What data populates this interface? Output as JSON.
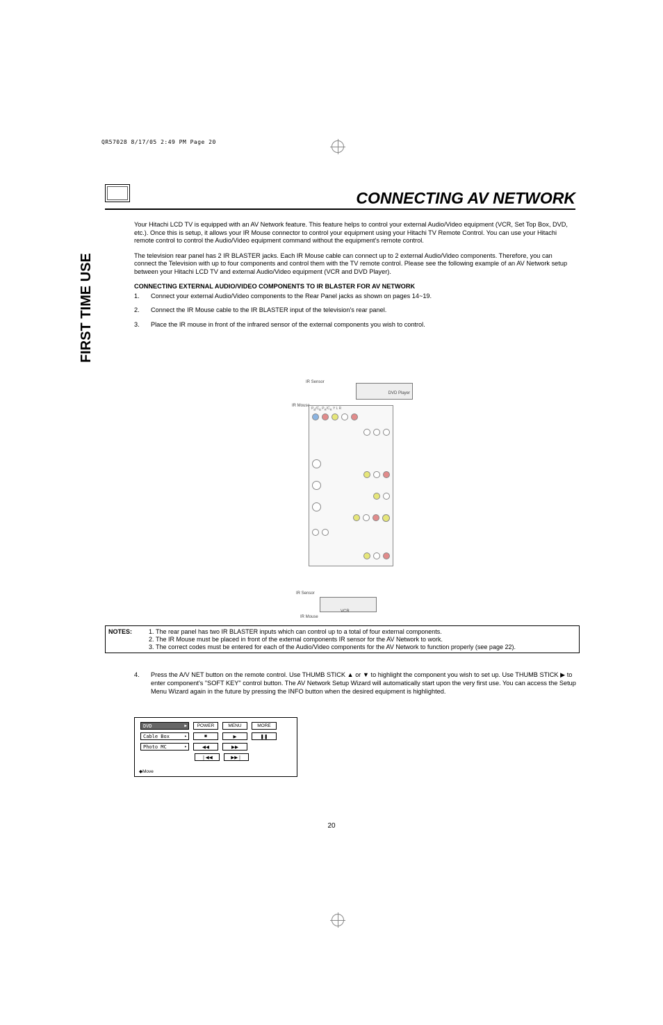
{
  "print_header": "QR57028  8/17/05  2:49 PM  Page 20",
  "title": "CONNECTING AV NETWORK",
  "side_label": "FIRST TIME USE",
  "intro_p1": "Your Hitachi LCD TV is equipped with an AV Network feature.  This feature helps to control your external Audio/Video equipment (VCR, Set Top Box, DVD, etc.).  Once this is setup, it allows your IR Mouse connector to control your equipment using your Hitachi TV Remote Control.  You can use your Hitachi remote control to control the Audio/Video equipment command without the equipment's remote control.",
  "intro_p2": "The television rear panel has 2 IR BLASTER jacks.  Each IR Mouse cable can connect up to 2 external Audio/Video components.  Therefore, you can connect the Television with up to four components and control them with the TV remote control.  Please see the following example of an AV Network setup between your Hitachi LCD TV and external Audio/Video equipment (VCR and DVD Player).",
  "sub_heading": "CONNECTING EXTERNAL AUDIO/VIDEO COMPONENTS TO IR BLASTER FOR AV NETWORK",
  "steps": [
    "Connect your external Audio/Video components to the Rear Panel jacks as shown on pages 14~19.",
    "Connect the IR Mouse cable to the IR BLASTER input of the television's rear panel.",
    "Place the IR mouse in front of the infrared sensor of the external components you wish to control."
  ],
  "diagram": {
    "dvd_label": "DVD Player",
    "vcr_label": "VCR",
    "ir_sensor_top": "IR Sensor",
    "ir_mouse_top": "IR Mouse",
    "ir_sensor_bottom": "IR Sensor",
    "ir_mouse_bottom": "IR Mouse"
  },
  "notes_label": "NOTES:",
  "notes": [
    "The rear panel has two IR BLASTER inputs which can control up to a total of four external components.",
    "The IR Mouse must be placed in front of the external components IR sensor for the AV Network to work.",
    "The correct codes must be entered for each of the Audio/Video components for the AV Network to function properly (see page 22)."
  ],
  "step4": "Press the A/V NET button on the remote control.  Use THUMB STICK ▲ or ▼ to highlight the component you wish to set up.  Use THUMB STICK ▶ to enter component's \"SOFT KEY\" control button.  The AV Network Setup Wizard will automatically start upon the very first use.  You can access the Setup Menu Wizard again in the future by pressing the INFO button when the desired equipment is highlighted.",
  "ui": {
    "rows": [
      {
        "left": "DVD",
        "selected": true,
        "buttons": [
          "POWER",
          "MENU",
          "MORE"
        ]
      },
      {
        "left": "Cable Box",
        "selected": false,
        "buttons": [
          "■",
          "▶",
          "❚❚"
        ]
      },
      {
        "left": "Photo MC",
        "selected": false,
        "buttons": [
          "◀◀",
          "▶▶",
          ""
        ]
      }
    ],
    "row4_buttons": [
      "❘◀◀",
      "▶▶❘"
    ],
    "move_label": "Move"
  },
  "page_number": "20"
}
